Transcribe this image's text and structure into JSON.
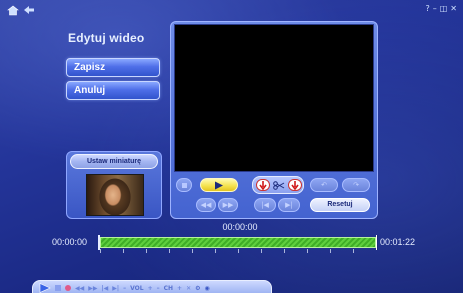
{
  "window": {
    "controls": [
      "?",
      "–",
      "◫",
      "✕"
    ]
  },
  "page": {
    "title": "Edytuj wideo"
  },
  "menu": {
    "save_label": "Zapisz",
    "cancel_label": "Anuluj"
  },
  "thumbnail": {
    "button_label": "Ustaw miniaturę"
  },
  "player": {
    "reset_label": "Resetuj",
    "current_time": "00:00:00"
  },
  "timeline": {
    "start_time": "00:00:00",
    "end_time": "00:01:22"
  },
  "transport": {
    "vol_label": "VOL",
    "ch_label": "CH"
  },
  "colors": {
    "accent_play": "#f4e14a",
    "timeline_fill": "#5fcf3e",
    "split_arrow": "#d01818"
  }
}
